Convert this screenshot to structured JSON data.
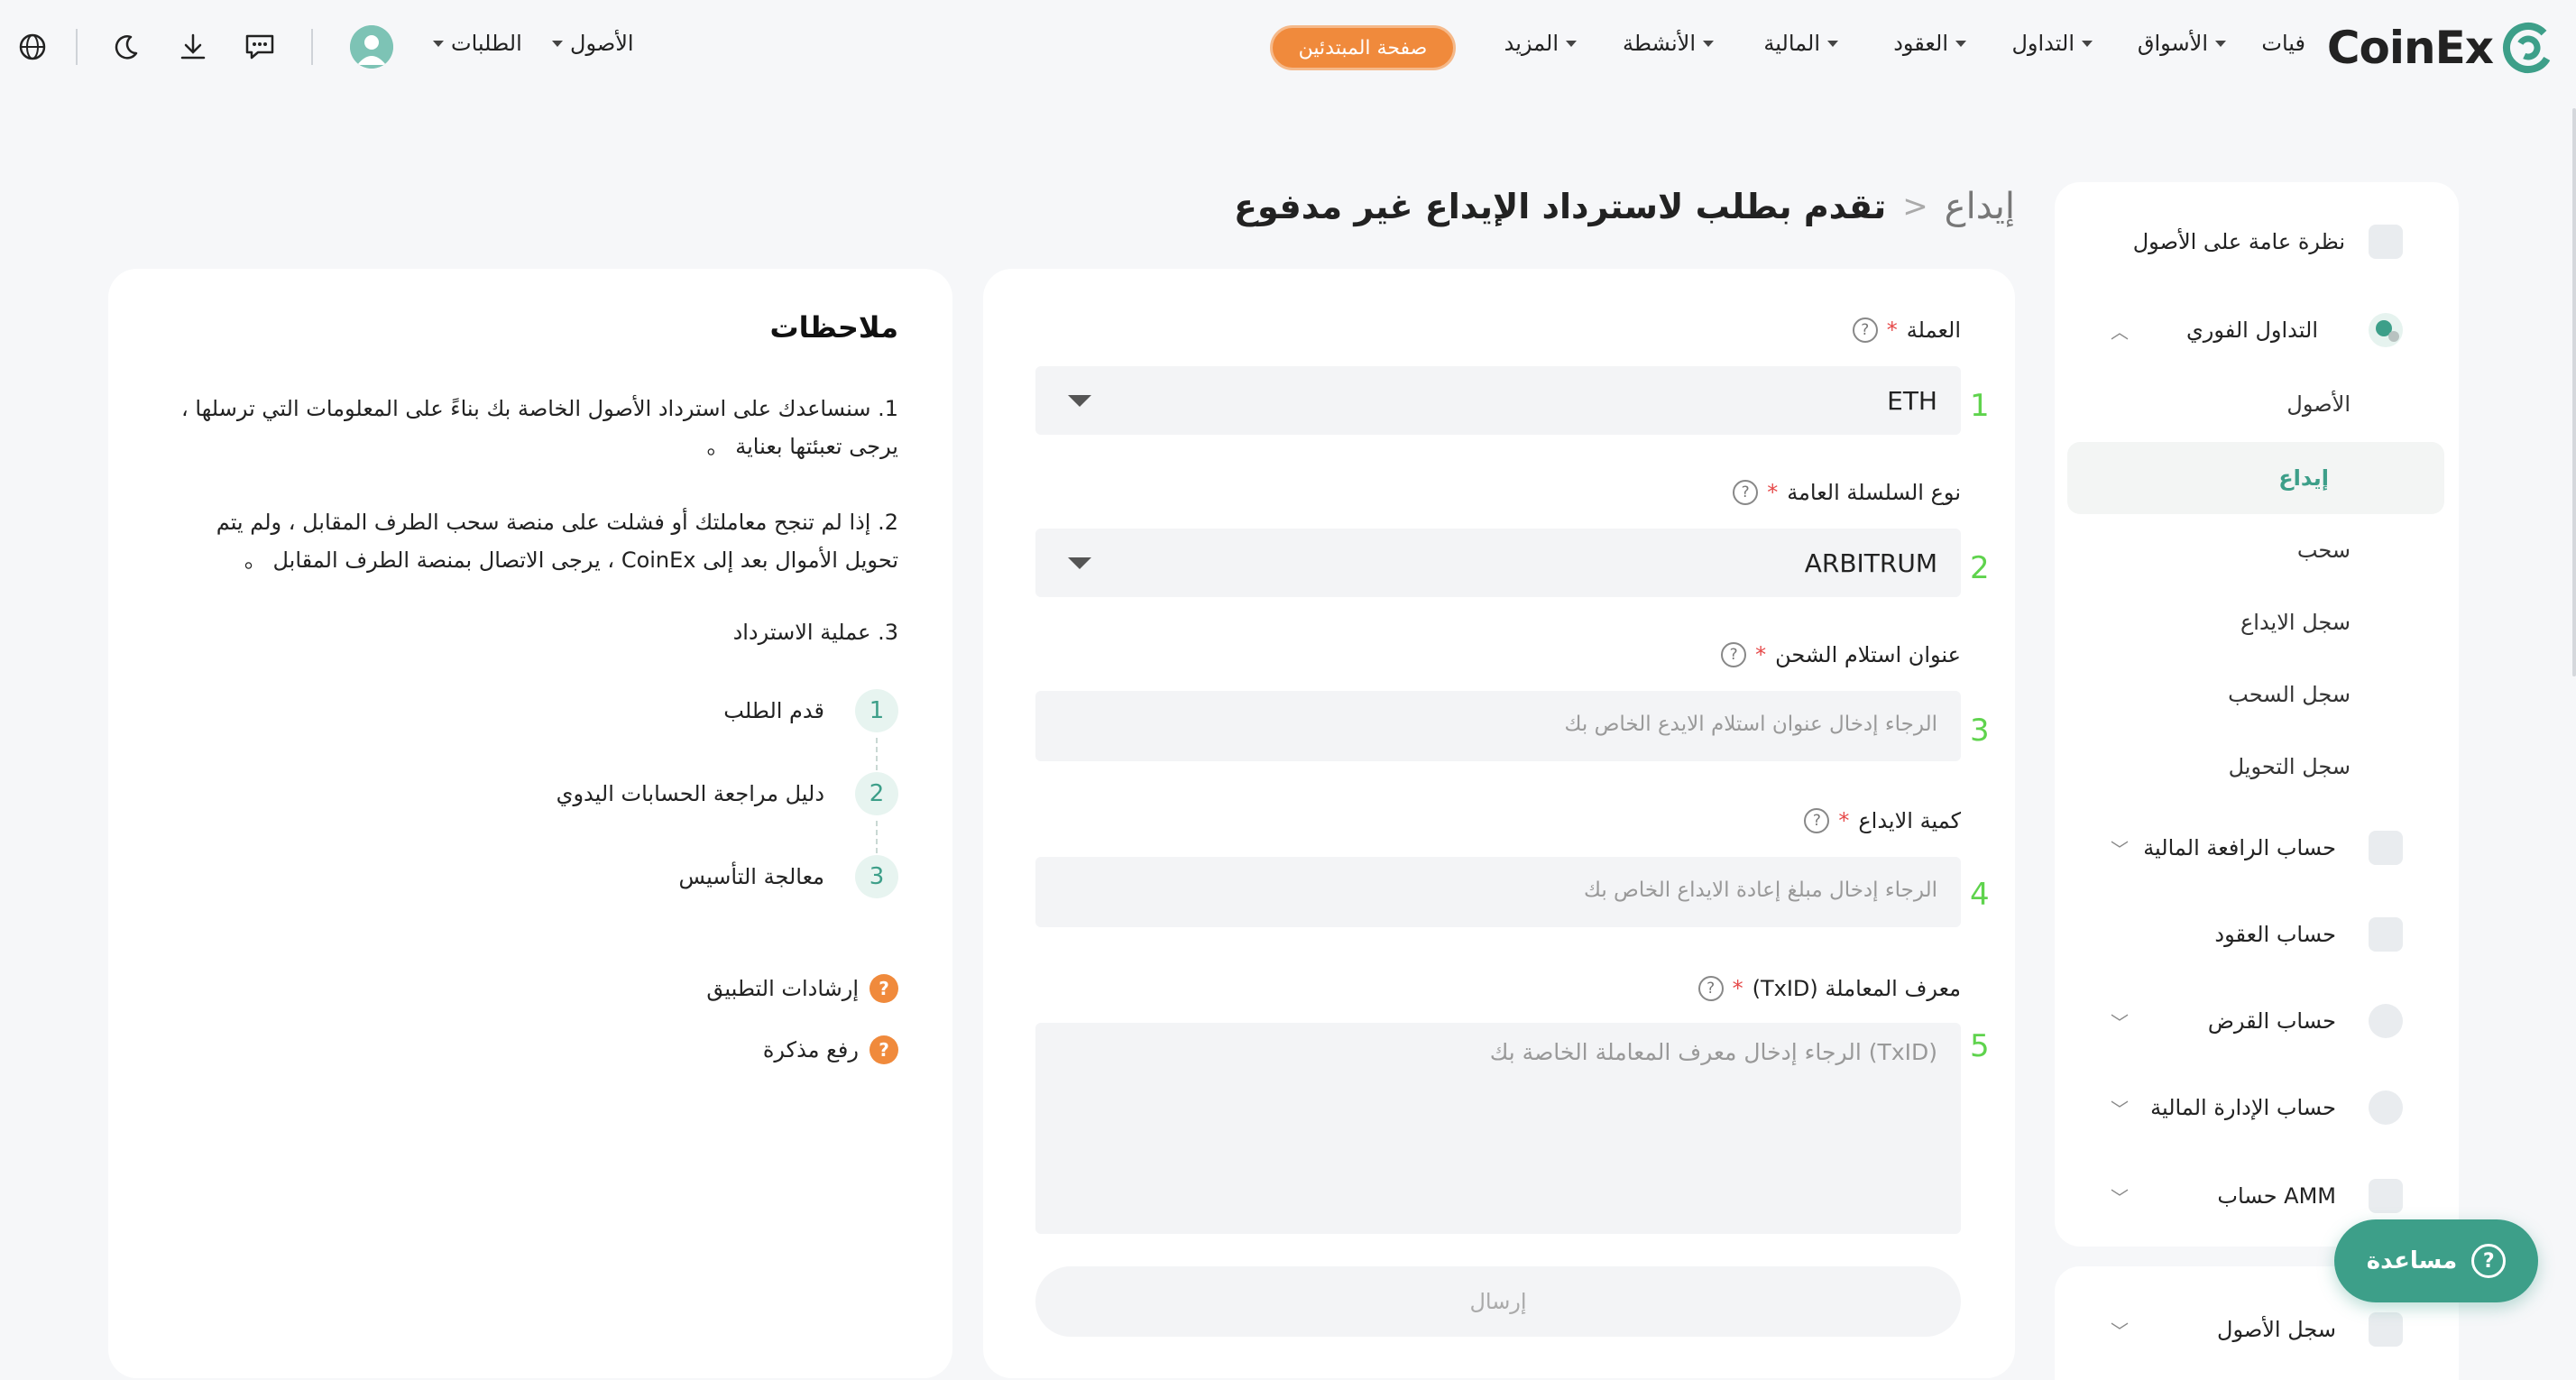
{
  "brand": {
    "name": "CoinEx",
    "accent": "#3d9f89",
    "orange": "#f08a3c"
  },
  "nav": {
    "fiat": "فيات",
    "markets": "الأسواق",
    "trading": "التداول",
    "futures": "العقود",
    "finance": "المالية",
    "activities": "الأنشطة",
    "more": "المزيد",
    "beginner": "صفحة المبتدئين",
    "assets": "الأصول",
    "orders": "الطلبات"
  },
  "toolbar_icons": [
    "chat-icon",
    "download-icon",
    "moon-icon",
    "globe-icon"
  ],
  "sidebar": {
    "overview": "نظرة عامة على الأصول",
    "spot": "التداول الفوري",
    "spot_items": [
      "الأصول",
      "إيداع",
      "سحب",
      "سجل الايداع",
      "سجل السحب",
      "سجل التحويل"
    ],
    "active_item": "إيداع",
    "margin": "حساب الرافعة المالية",
    "futures": "حساب العقود",
    "loan": "حساب القرض",
    "financial": "حساب الإدارة المالية",
    "amm": "حساب AMM",
    "asset_history": "سجل الأصول"
  },
  "breadcrumb": {
    "root": "إيداع",
    "separator": "<",
    "title": "تقدم بطلب لاسترداد الإيداع غير مدفوع"
  },
  "form": {
    "coin_label": "العملة",
    "coin_value": "ETH",
    "chain_label": "نوع السلسلة العامة",
    "chain_value": "ARBITRUM",
    "address_label": "عنوان استلام الشحن",
    "address_placeholder": "الرجاء إدخال عنوان استلام الايدع الخاص بك",
    "amount_label": "كمية الايداع",
    "amount_placeholder": "الرجاء إدخال مبلغ إعادة الايداع الخاص بك",
    "txid_label": "معرف المعاملة (TxID)",
    "txid_placeholder": "الرجاء إدخال معرف المعاملة الخاصة بك (TxID)",
    "required_mark": "*",
    "help_mark": "?",
    "step_numbers": [
      "1",
      "2",
      "3",
      "4",
      "5"
    ],
    "submit": "إرسال"
  },
  "notes": {
    "title": "ملاحظات",
    "note1": "1. سنساعدك على استرداد الأصول الخاصة بك بناءً على المعلومات التي ترسلها ، يرجى تعبئتها بعناية 。",
    "note2": "2. إذا لم تنجح معاملتك أو فشلت على منصة سحب الطرف المقابل ، ولم يتم تحويل الأموال بعد إلى CoinEx ، يرجى الاتصال بمنصة الطرف المقابل 。",
    "note3": "3. عملية الاسترداد",
    "steps": [
      {
        "num": "1",
        "text": "قدم الطلب"
      },
      {
        "num": "2",
        "text": "دليل مراجعة الحسابات اليدوي"
      },
      {
        "num": "3",
        "text": "معالجة التأسيس"
      }
    ],
    "guide": "إرشادات التطبيق",
    "ticket": "رفع مذكرة"
  },
  "help_button": "مساعدة"
}
